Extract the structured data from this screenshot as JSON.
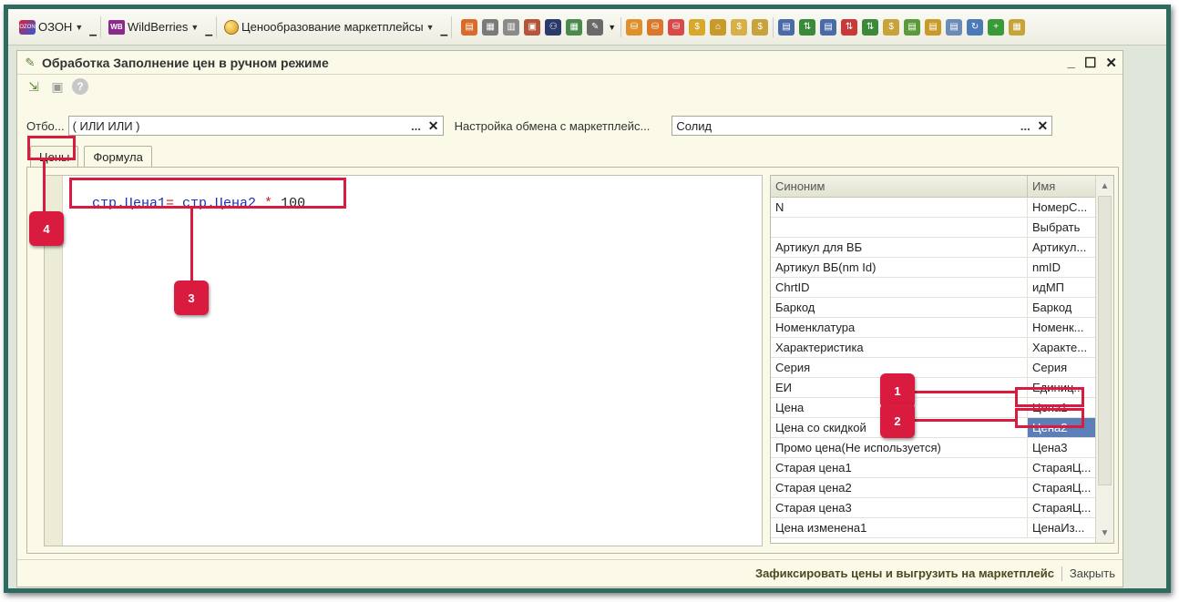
{
  "toolbar": {
    "ozon_label": "ОЗОН",
    "ozon_logo_text": "OZON",
    "wb_label": "WildBerries",
    "wb_logo_text": "WB",
    "pricing_label": "Ценообразование маркетплейсы"
  },
  "window": {
    "title": "Обработка  Заполнение цен в ручном режиме",
    "controls": [
      "_",
      "☐",
      "✕"
    ]
  },
  "filters": {
    "otbor_label": "Отбо...",
    "otbor_value": "( ИЛИ ИЛИ )",
    "exchange_label": "Настройка обмена с маркетплейс...",
    "exchange_value": "Солид"
  },
  "tabs": [
    "Цены",
    "Формула"
  ],
  "formula": {
    "part1": "стр.Цена1",
    "op1": "=",
    "part2": " стр.Цена2",
    "op2": " *",
    "num": " 100"
  },
  "grid": {
    "columns": [
      "Синоним",
      "Имя"
    ],
    "rows": [
      {
        "synonym": "N",
        "name": "НомерС..."
      },
      {
        "synonym": "",
        "name": "Выбрать"
      },
      {
        "synonym": "Артикул для ВБ",
        "name": "Артикул..."
      },
      {
        "synonym": "Артикул ВБ(nm Id)",
        "name": "nmID"
      },
      {
        "synonym": "ChrtID",
        "name": "идМП"
      },
      {
        "synonym": "Баркод",
        "name": "Баркод"
      },
      {
        "synonym": "Номенклатура",
        "name": "Номенк..."
      },
      {
        "synonym": "Характеристика",
        "name": "Характе..."
      },
      {
        "synonym": "Серия",
        "name": "Серия"
      },
      {
        "synonym": "ЕИ",
        "name": "Единиц..."
      },
      {
        "synonym": "Цена",
        "name": "Цена1"
      },
      {
        "synonym": "Цена со скидкой",
        "name": "Цена2"
      },
      {
        "synonym": "Промо цена(Не используется)",
        "name": "Цена3"
      },
      {
        "synonym": "Старая цена1",
        "name": "СтараяЦ..."
      },
      {
        "synonym": "Старая цена2",
        "name": "СтараяЦ..."
      },
      {
        "synonym": "Старая цена3",
        "name": "СтараяЦ..."
      },
      {
        "synonym": "Цена изменена1",
        "name": "ЦенаИз..."
      }
    ]
  },
  "footer": {
    "primary": "Зафиксировать цены и выгрузить на маркетплейс",
    "close": "Закрыть"
  },
  "callouts": [
    "1",
    "2",
    "3",
    "4"
  ],
  "colors": {
    "accent_red": "#d81b3f",
    "frame_green": "#2e6b5e",
    "selection_blue": "#5c7fb8"
  }
}
